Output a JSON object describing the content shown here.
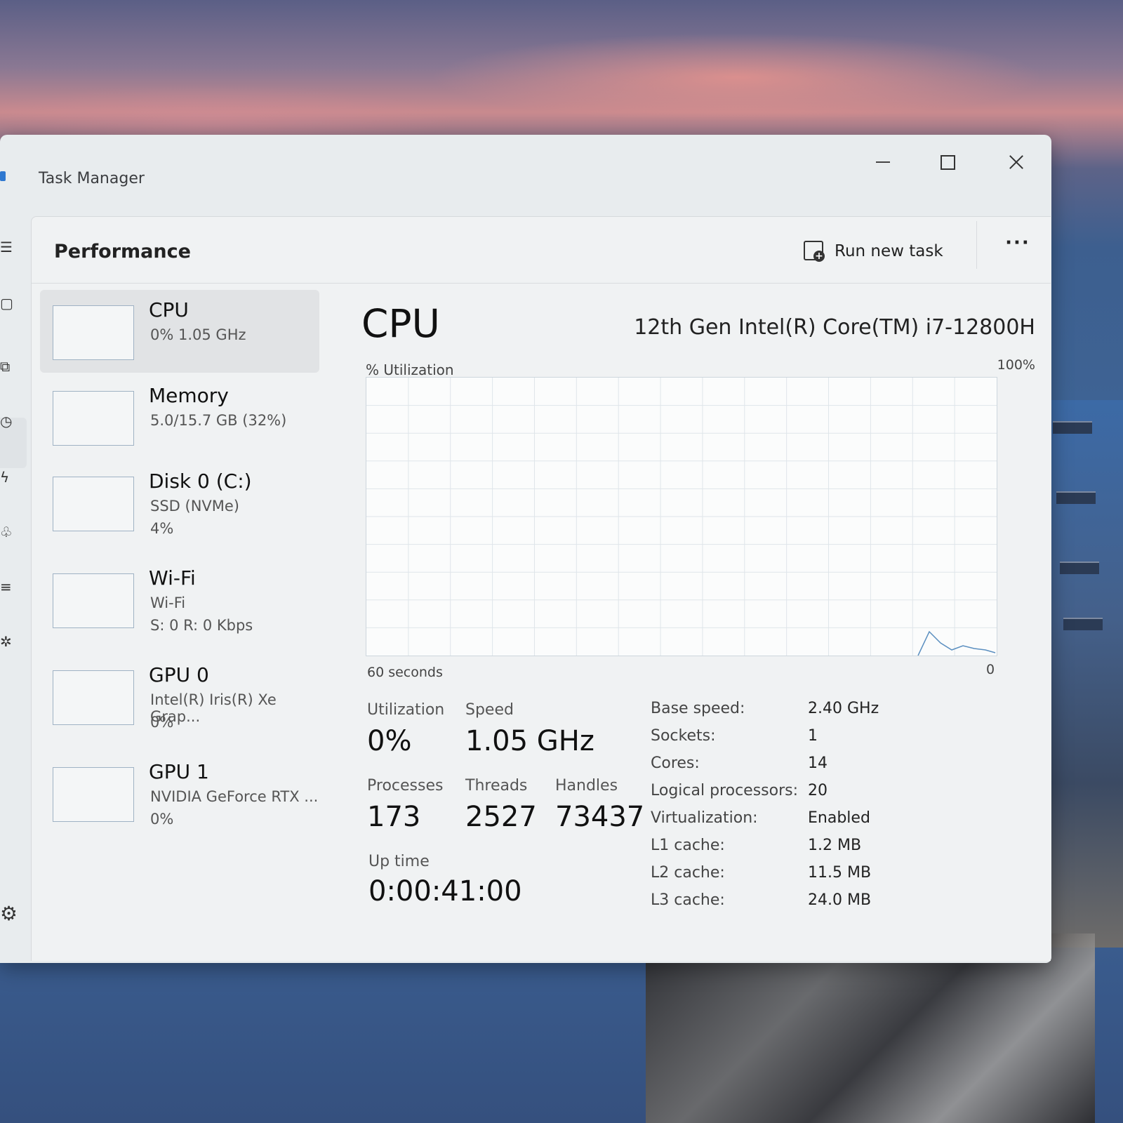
{
  "window": {
    "title": "Task Manager"
  },
  "header": {
    "page_title": "Performance",
    "run_new_task": "Run new task",
    "more": "···"
  },
  "sidebar": {
    "items": [
      {
        "title": "CPU",
        "line1": "0%  1.05 GHz",
        "line2": ""
      },
      {
        "title": "Memory",
        "line1": "5.0/15.7 GB (32%)",
        "line2": ""
      },
      {
        "title": "Disk 0 (C:)",
        "line1": "SSD (NVMe)",
        "line2": "4%"
      },
      {
        "title": "Wi-Fi",
        "line1": "Wi-Fi",
        "line2": "S: 0  R: 0 Kbps"
      },
      {
        "title": "GPU 0",
        "line1": "Intel(R) Iris(R) Xe Grap...",
        "line2": "0%"
      },
      {
        "title": "GPU 1",
        "line1": "NVIDIA GeForce RTX ...",
        "line2": "0%"
      }
    ]
  },
  "main": {
    "heading": "CPU",
    "model": "12th Gen Intel(R) Core(TM) i7-12800H",
    "util_label": "% Utilization",
    "max_label": "100%",
    "time_label": "60 seconds",
    "min_label": "0",
    "stats": {
      "utilization_label": "Utilization",
      "utilization": "0%",
      "speed_label": "Speed",
      "speed": "1.05 GHz",
      "processes_label": "Processes",
      "processes": "173",
      "threads_label": "Threads",
      "threads": "2527",
      "handles_label": "Handles",
      "handles": "73437",
      "uptime_label": "Up time",
      "uptime": "0:00:41:00"
    },
    "specs": [
      {
        "key": "Base speed:",
        "value": "2.40 GHz"
      },
      {
        "key": "Sockets:",
        "value": "1"
      },
      {
        "key": "Cores:",
        "value": "14"
      },
      {
        "key": "Logical processors:",
        "value": "20"
      },
      {
        "key": "Virtualization:",
        "value": "Enabled"
      },
      {
        "key": "L1 cache:",
        "value": "1.2 MB"
      },
      {
        "key": "L2 cache:",
        "value": "11.5 MB"
      },
      {
        "key": "L3 cache:",
        "value": "24.0 MB"
      }
    ]
  },
  "colors": {
    "graph_line": "#5b8fc0",
    "grid": "#dfe5ea",
    "accent": "#2f78d0"
  },
  "icons": [
    "minimize-icon",
    "maximize-icon",
    "close-icon",
    "run-task-icon",
    "more-icon",
    "settings-icon"
  ]
}
